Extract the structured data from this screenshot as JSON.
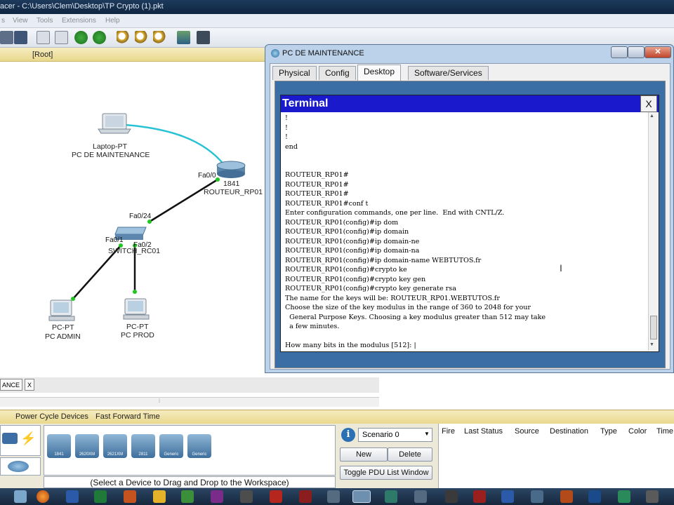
{
  "app": {
    "title_partial": "acer - C:\\Users\\Clem\\Desktop\\TP Crypto (1).pkt",
    "menu": [
      "s",
      "View",
      "Tools",
      "Extensions",
      "Help"
    ],
    "root_label": "[Root]"
  },
  "workspace": {
    "laptop": {
      "type": "Laptop-PT",
      "name": "PC DE MAINTENANCE"
    },
    "router": {
      "model": "1841",
      "name": "ROUTEUR_RP01",
      "port": "Fa0/0"
    },
    "switch": {
      "name": "SWITCH_RC01",
      "port_uplink": "Fa0/24",
      "port1": "Fa0/1",
      "port2": "Fa0/2"
    },
    "pc_admin": {
      "type": "PC-PT",
      "name": "PC ADMIN"
    },
    "pc_prod": {
      "type": "PC-PT",
      "name": "PC PROD"
    },
    "tab_label": "ANCE",
    "tab_close": "X"
  },
  "pc_window": {
    "title": "PC DE MAINTENANCE",
    "tabs": [
      "Physical",
      "Config",
      "Desktop",
      "Software/Services"
    ],
    "active_tab": "Desktop",
    "terminal": {
      "title": "Terminal",
      "close": "X",
      "lines": [
        "!",
        "!",
        "!",
        "end",
        "",
        "",
        "ROUTEUR_RP01#",
        "ROUTEUR_RP01#",
        "ROUTEUR_RP01#",
        "ROUTEUR_RP01#conf t",
        "Enter configuration commands, one per line.  End with CNTL/Z.",
        "ROUTEUR_RP01(config)#ip dom",
        "ROUTEUR_RP01(config)#ip domain",
        "ROUTEUR_RP01(config)#ip domain-ne",
        "ROUTEUR_RP01(config)#ip domain-na",
        "ROUTEUR_RP01(config)#ip domain-name WEBTUTOS.fr",
        "ROUTEUR_RP01(config)#crypto ke",
        "ROUTEUR_RP01(config)#crypto key gen",
        "ROUTEUR_RP01(config)#crypto key generate rsa",
        "The name for the keys will be: ROUTEUR_RP01.WEBTUTOS.fr",
        "Choose the size of the key modulus in the range of 360 to 2048 for your",
        "  General Purpose Keys. Choosing a key modulus greater than 512 may take",
        "  a few minutes.",
        "",
        "How many bits in the modulus [512]: |"
      ]
    }
  },
  "bottom": {
    "realtime": {
      "power_cycle": "Power Cycle Devices",
      "fast_forward": "Fast Forward Time"
    },
    "router_models": [
      "1841",
      "2620XM",
      "2621XM",
      "2811",
      "Generic",
      "Generic"
    ],
    "hint": "(Select a Device to Drag and Drop to the Workspace)",
    "scenario": {
      "value": "Scenario 0",
      "new": "New",
      "delete": "Delete",
      "toggle": "Toggle PDU List Window"
    },
    "pdu_columns": [
      "Fire",
      "Last Status",
      "Source",
      "Destination",
      "Type",
      "Color",
      "Time"
    ]
  },
  "colors": {
    "cable_console": "#27c3d4",
    "cable_straight": "#111111",
    "link_up": "#1ec81e",
    "terminal_head": "#1a1acc"
  }
}
